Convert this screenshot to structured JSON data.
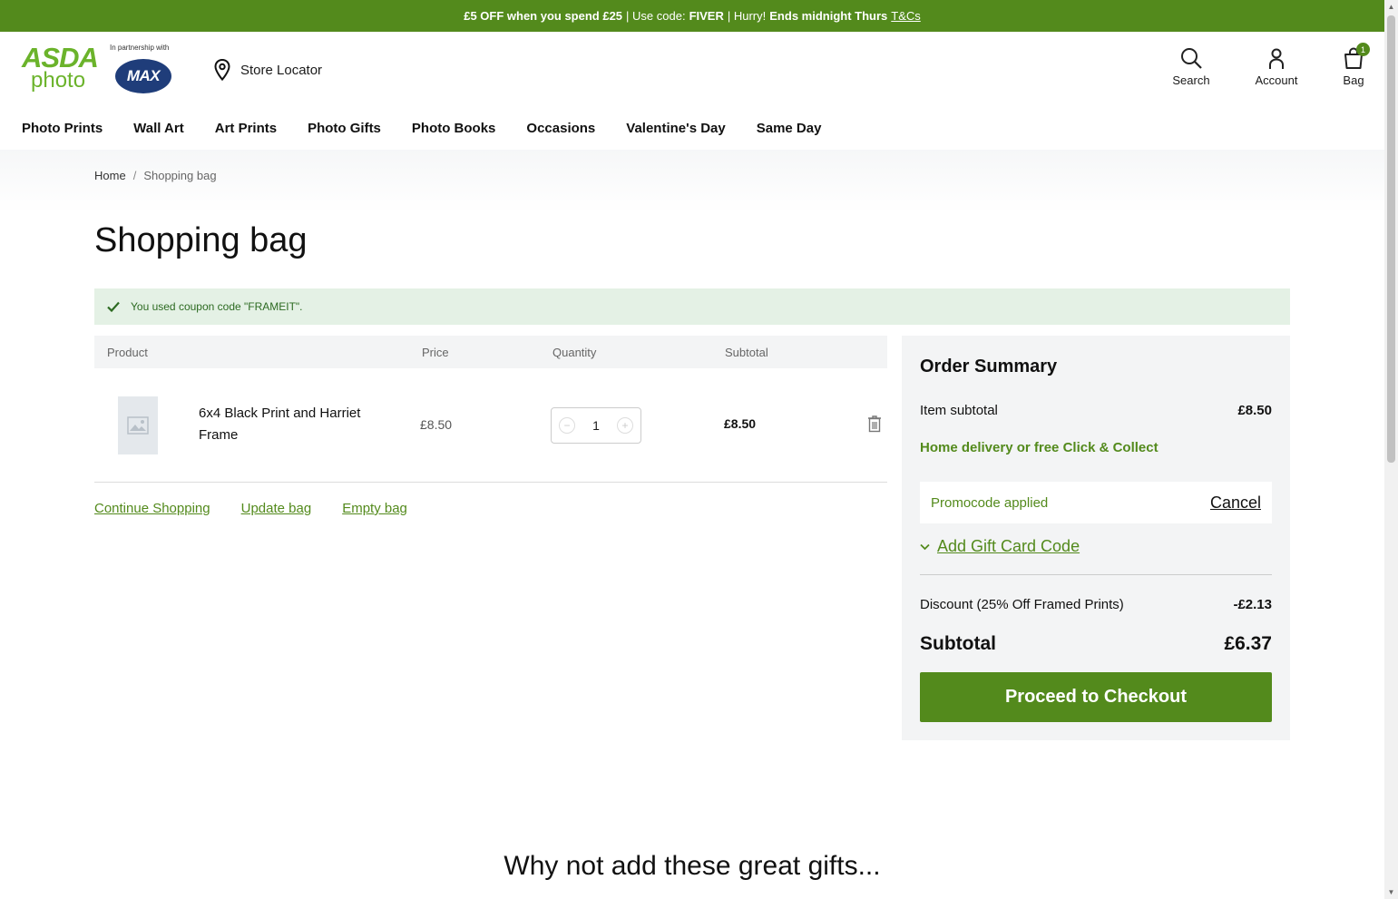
{
  "promo": {
    "p1": "£5 OFF when you spend £25",
    "p2": "| Use code:",
    "code": "FIVER",
    "p3": "| Hurry!",
    "p4": "Ends midnight Thurs",
    "tc": "T&Cs"
  },
  "header": {
    "logo_top": "ASDA",
    "logo_bottom": "photo",
    "partner_text": "In partnership with",
    "partner_logo": "MAX",
    "store_locator": "Store Locator",
    "search": "Search",
    "account": "Account",
    "bag": "Bag",
    "bag_count": "1"
  },
  "nav": [
    "Photo Prints",
    "Wall Art",
    "Art Prints",
    "Photo Gifts",
    "Photo Books",
    "Occasions",
    "Valentine's Day",
    "Same Day"
  ],
  "breadcrumb": {
    "home": "Home",
    "sep": "/",
    "current": "Shopping bag"
  },
  "page_title": "Shopping bag",
  "coupon_message": "You used coupon code \"FRAMEIT\".",
  "cart": {
    "headers": {
      "product": "Product",
      "price": "Price",
      "quantity": "Quantity",
      "subtotal": "Subtotal"
    },
    "items": [
      {
        "name": "6x4 Black Print and Harriet Frame",
        "price": "£8.50",
        "quantity": "1",
        "subtotal": "£8.50"
      }
    ],
    "actions": {
      "continue": "Continue Shopping",
      "update": "Update bag",
      "empty": "Empty bag"
    }
  },
  "summary": {
    "title": "Order Summary",
    "item_subtotal_label": "Item subtotal",
    "item_subtotal_value": "£8.50",
    "delivery": "Home delivery or free Click & Collect",
    "promo_applied": "Promocode applied",
    "cancel": "Cancel",
    "gift_card": "Add Gift Card Code",
    "discount_label": "Discount (25% Off Framed Prints)",
    "discount_value": "-£2.13",
    "subtotal_label": "Subtotal",
    "subtotal_value": "£6.37",
    "checkout": "Proceed to Checkout"
  },
  "gifts_title": "Why not add these great gifts...",
  "colors": {
    "brand_green": "#538A1C",
    "logo_green": "#6BB32B",
    "success_bg": "#E4F1E5"
  }
}
